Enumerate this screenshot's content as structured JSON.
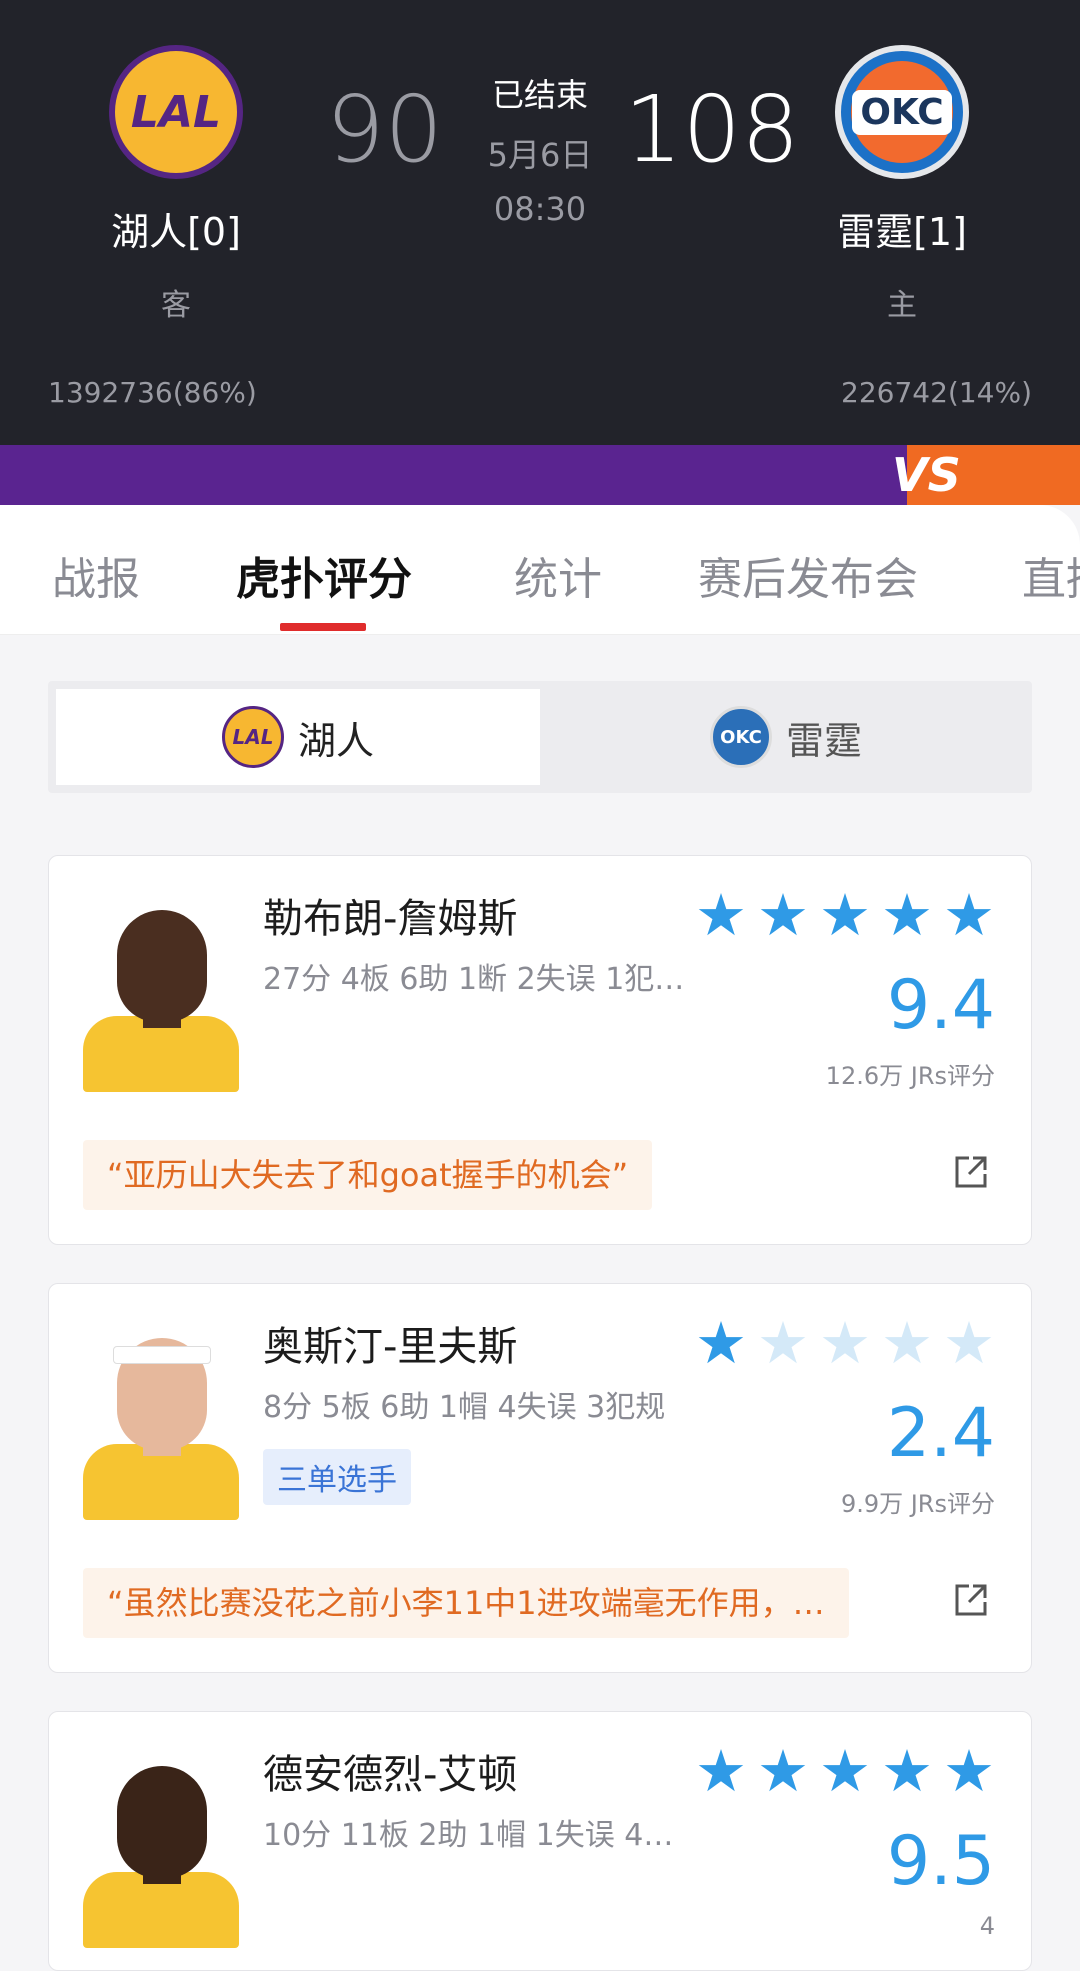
{
  "game": {
    "away": {
      "name": "湖人[0]",
      "side": "客",
      "votes": "1392736(86%)",
      "score": "90",
      "logo_text": "LAL"
    },
    "home": {
      "name": "雷霆[1]",
      "side": "主",
      "votes": "226742(14%)",
      "score": "108",
      "logo_text": "OKC"
    },
    "status": "已结束",
    "date": "5月6日",
    "time": "08:30"
  },
  "vs_label": "VS",
  "tabs": [
    {
      "label": "战报"
    },
    {
      "label": "虎扑评分"
    },
    {
      "label": "统计"
    },
    {
      "label": "赛后发布会"
    },
    {
      "label": "直播"
    }
  ],
  "team_toggle": {
    "selected": {
      "label": "湖人",
      "logo_text": "LAL"
    },
    "other": {
      "label": "雷霆",
      "logo_text": "OKC"
    }
  },
  "players": [
    {
      "name": "勒布朗-詹姆斯",
      "stats": "27分 4板 6助 1断 2失误 1犯…",
      "tag": "",
      "stars": 5,
      "score": "9.4",
      "votes": "12.6万 JRs评分",
      "comment": "“亚历山大失去了和goat握手的机会”"
    },
    {
      "name": "奥斯汀-里夫斯",
      "stats": "8分 5板 6助 1帽 4失误 3犯规",
      "tag": "三单选手",
      "stars": 1,
      "score": "2.4",
      "votes": "9.9万 JRs评分",
      "comment": "“虽然比赛没花之前小李11中1进攻端毫无作用，…"
    },
    {
      "name": "德安德烈-艾顿",
      "stats": "10分 11板 2助 1帽 1失误 4…",
      "tag": "",
      "stars": 5,
      "score": "9.5",
      "votes": "4",
      "comment": ""
    }
  ],
  "colors": {
    "header_bg": "#22232a",
    "lakers_purple": "#552583",
    "lakers_gold": "#f7b731",
    "accent_blue": "#2f9ae6",
    "tab_indicator": "#e02c2c",
    "comment_orange": "#e06a22"
  }
}
